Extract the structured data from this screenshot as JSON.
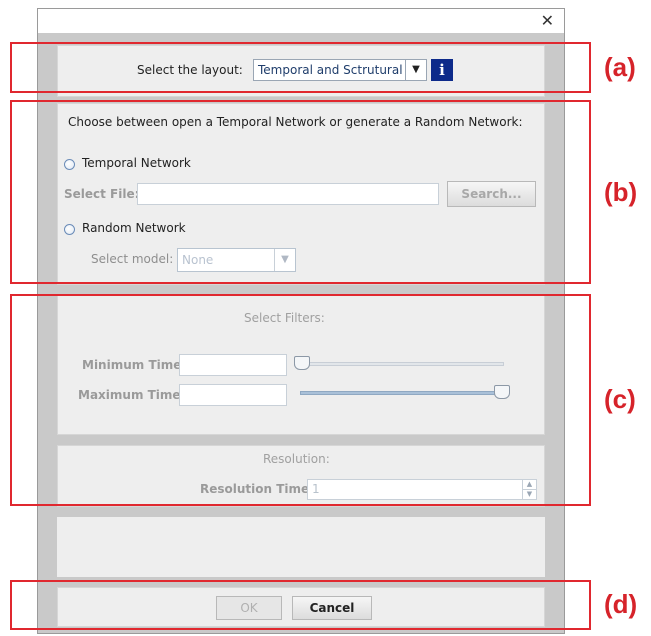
{
  "layout_section": {
    "label": "Select the layout:",
    "selected": "Temporal and Sctrutural",
    "info_label": "i"
  },
  "network_section": {
    "prompt": "Choose between open a Temporal Network or generate a Random Network:",
    "temporal_option": "Temporal Network",
    "file_label": "Select File:",
    "file_value": "",
    "search_label": "Search...",
    "random_option": "Random Network",
    "model_label": "Select model:",
    "model_value": "None"
  },
  "filters_section": {
    "title": "Select Filters:",
    "min_label": "Minimum Time",
    "min_value": "",
    "max_label": "Maximum Time",
    "max_value": "",
    "min_slider_level": 0.0,
    "max_slider_level": 1.0
  },
  "resolution_section": {
    "title": "Resolution:",
    "label": "Resolution Time",
    "value": "1"
  },
  "footer": {
    "ok_label": "OK",
    "cancel_label": "Cancel"
  },
  "annotations": [
    "(a)",
    "(b)",
    "(c)",
    "(d)"
  ],
  "colors": {
    "highlight": "#e0282f",
    "info_button": "#0d2a8a"
  }
}
